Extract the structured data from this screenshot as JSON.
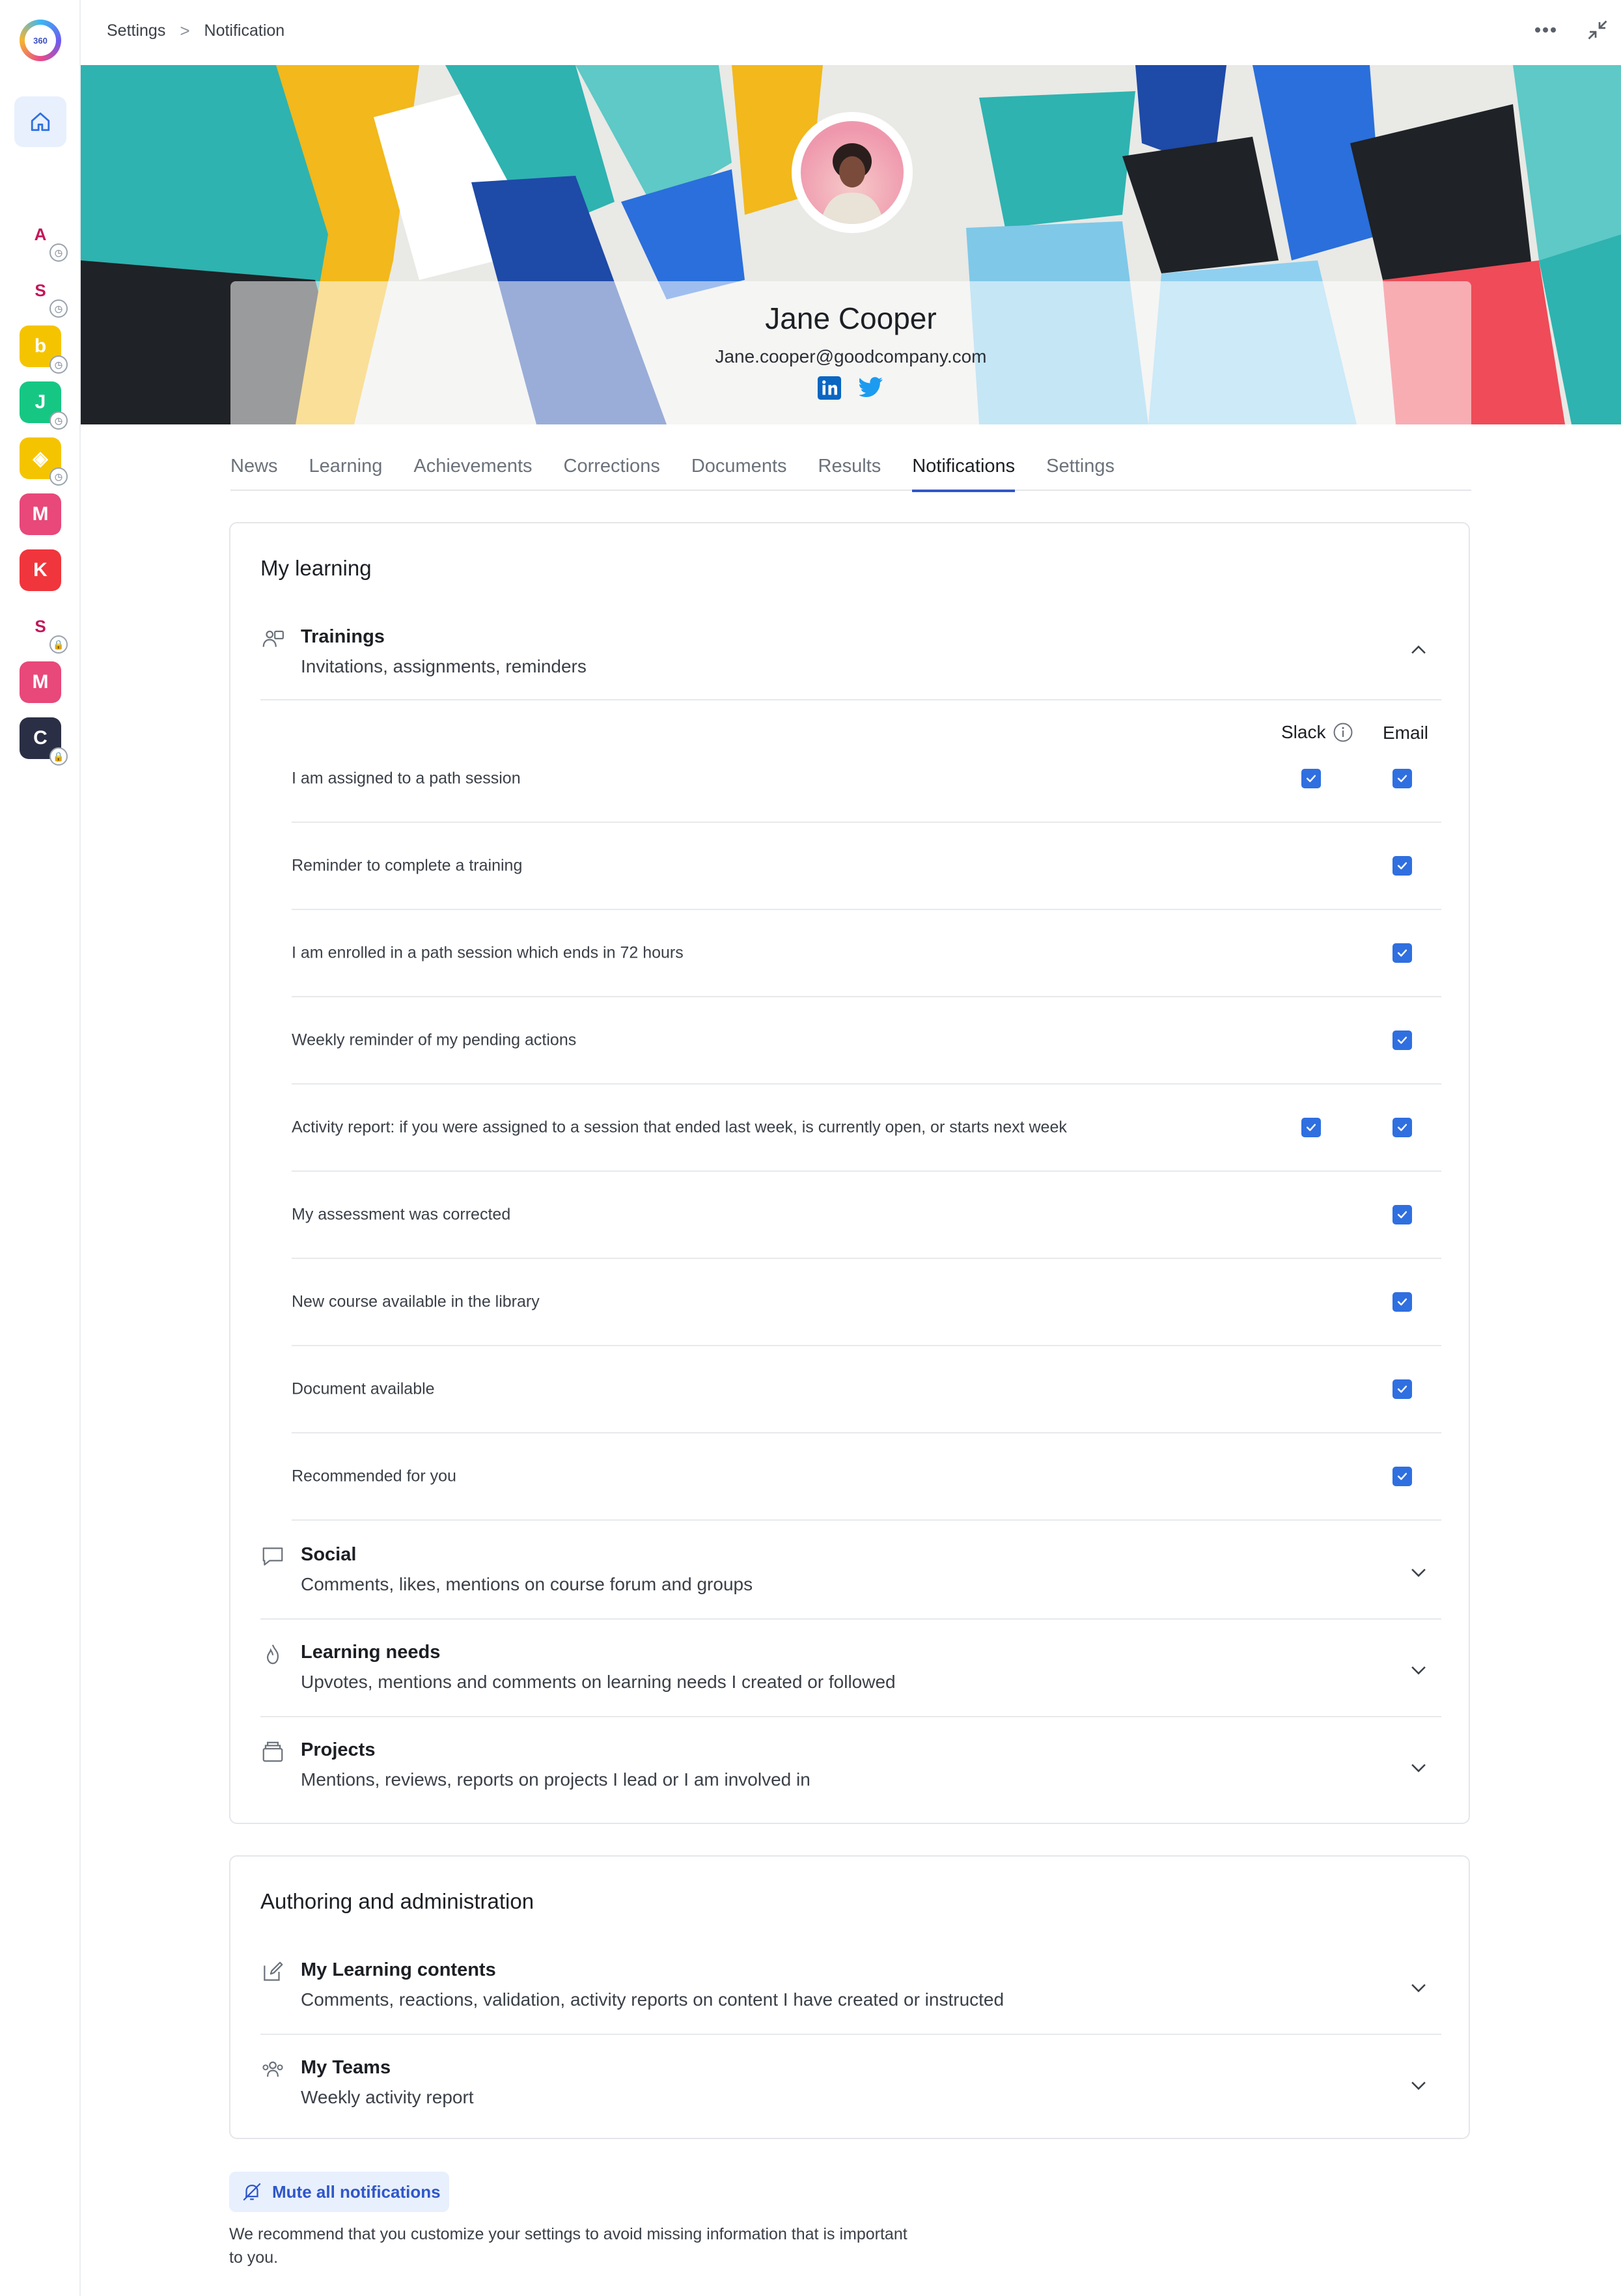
{
  "sidebar": {
    "logo_text": "360",
    "apps": [
      {
        "name": "app-1",
        "color": "#ffffff",
        "glyph": "A",
        "badge": "clock"
      },
      {
        "name": "app-2",
        "color": "#ffffff",
        "glyph": "S",
        "badge": "clock"
      },
      {
        "name": "app-3",
        "color": "#f5c400",
        "glyph": "b",
        "badge": "clock"
      },
      {
        "name": "app-4",
        "color": "#16c784",
        "glyph": "J",
        "badge": "clock"
      },
      {
        "name": "app-5",
        "color": "#f5c400",
        "glyph": "◈",
        "badge": "clock"
      },
      {
        "name": "app-6",
        "color": "#e8487a",
        "glyph": "M",
        "badge": ""
      },
      {
        "name": "app-7",
        "color": "#f0353c",
        "glyph": "K",
        "badge": ""
      },
      {
        "name": "app-8",
        "color": "#ffffff",
        "glyph": "S",
        "badge": "lock"
      },
      {
        "name": "app-9",
        "color": "#e8487a",
        "glyph": "M",
        "badge": ""
      },
      {
        "name": "app-10",
        "color": "#2b2f45",
        "glyph": "C",
        "badge": "lock"
      }
    ]
  },
  "breadcrumb": {
    "parent": "Settings",
    "separator": ">",
    "current": "Notification"
  },
  "profile": {
    "name": "Jane Cooper",
    "email": "Jane.cooper@goodcompany.com",
    "socials": [
      "linkedin-icon",
      "twitter-icon"
    ]
  },
  "tabs": [
    {
      "label": "News",
      "active": false
    },
    {
      "label": "Learning",
      "active": false
    },
    {
      "label": "Achievements",
      "active": false
    },
    {
      "label": "Corrections",
      "active": false
    },
    {
      "label": "Documents",
      "active": false
    },
    {
      "label": "Results",
      "active": false
    },
    {
      "label": "Notifications",
      "active": true
    },
    {
      "label": "Settings",
      "active": false
    }
  ],
  "my_learning": {
    "title": "My learning",
    "trainings": {
      "title": "Trainings",
      "subtitle": "Invitations, assignments, reminders",
      "expanded": true,
      "columns": {
        "slack": "Slack",
        "email": "Email"
      },
      "rows": [
        {
          "label": "I am assigned to a path session",
          "slack": true,
          "email": true
        },
        {
          "label": "Reminder to complete a training",
          "slack": null,
          "email": true
        },
        {
          "label": "I am enrolled in a path session which ends in 72 hours",
          "slack": null,
          "email": true
        },
        {
          "label": "Weekly reminder of my pending actions",
          "slack": null,
          "email": true
        },
        {
          "label": "Activity report: if you were assigned to a session that ended last week, is currently open, or starts next week",
          "slack": true,
          "email": true
        },
        {
          "label": "My assessment was corrected",
          "slack": null,
          "email": true
        },
        {
          "label": "New course available in the library",
          "slack": null,
          "email": true
        },
        {
          "label": "Document available",
          "slack": null,
          "email": true
        },
        {
          "label": "Recommended for you",
          "slack": null,
          "email": true
        }
      ]
    },
    "social": {
      "title": "Social",
      "subtitle": "Comments, likes, mentions on course forum and groups"
    },
    "learning_needs": {
      "title": "Learning needs",
      "subtitle": "Upvotes, mentions and comments on learning needs I created or followed"
    },
    "projects": {
      "title": "Projects",
      "subtitle": "Mentions, reviews, reports on projects I lead or I am involved in"
    }
  },
  "authoring": {
    "title": "Authoring and administration",
    "learning_contents": {
      "title": "My Learning contents",
      "subtitle": "Comments, reactions, validation, activity reports on content I have created or instructed"
    },
    "teams": {
      "title": "My Teams",
      "subtitle": "Weekly activity report"
    }
  },
  "footer": {
    "mute_label": "Mute all notifications",
    "note": "We recommend that you customize your settings to avoid missing information that is important to you."
  },
  "colors": {
    "accent": "#2f56c9",
    "checkbox": "#2f6fe0",
    "muted_bg": "#e8f0fd"
  }
}
